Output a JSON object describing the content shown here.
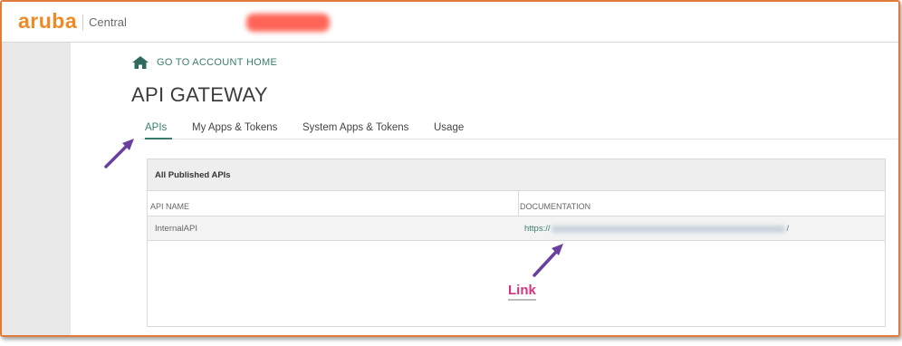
{
  "header": {
    "logo": "aruba",
    "product": "Central"
  },
  "nav": {
    "home_link": "GO TO ACCOUNT HOME",
    "home_icon": "home-icon"
  },
  "page": {
    "title": "API GATEWAY"
  },
  "tabs": [
    {
      "label": "APIs",
      "active": true
    },
    {
      "label": "My Apps & Tokens",
      "active": false
    },
    {
      "label": "System Apps & Tokens",
      "active": false
    },
    {
      "label": "Usage",
      "active": false
    }
  ],
  "panel": {
    "title": "All Published APIs",
    "columns": [
      "API NAME",
      "DOCUMENTATION"
    ],
    "rows": [
      {
        "name": "InternalAPI",
        "doc_prefix": "https://",
        "doc_suffix": "/"
      }
    ]
  },
  "annotations": {
    "link_label": "Link",
    "arrow_color": "#6b3fa0",
    "label_color": "#d63384"
  },
  "colors": {
    "accent": "#3a7d6f",
    "brand": "#f08a24",
    "frame": "#e07b39"
  }
}
